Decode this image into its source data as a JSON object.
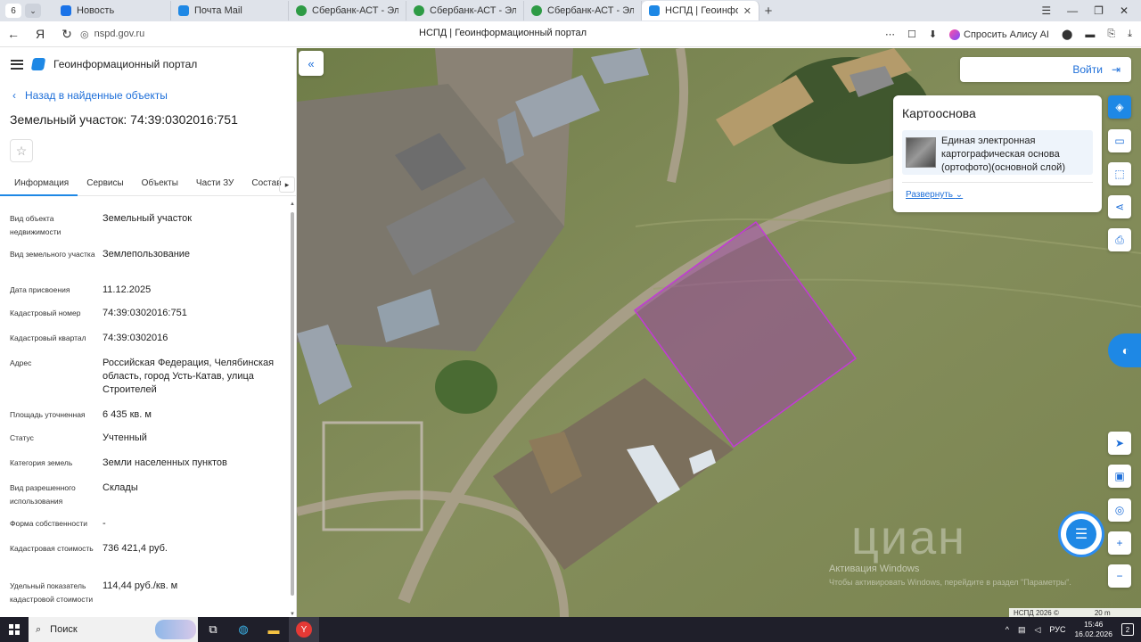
{
  "browser": {
    "tab_count": "6",
    "tabs": [
      {
        "title": "Новость",
        "color": "#1a73e8"
      },
      {
        "title": "Почта Mail",
        "color": "#1e88e5"
      },
      {
        "title": "Сбербанк-АСТ - Электрон",
        "color": "#2e9b45"
      },
      {
        "title": "Сбербанк-АСТ - Электрон",
        "color": "#2e9b45"
      },
      {
        "title": "Сбербанк-АСТ - Электрон",
        "color": "#2e9b45"
      },
      {
        "title": "НСПД | Геоинформацио",
        "color": "#1e88e5"
      }
    ],
    "url": "nspd.gov.ru",
    "page_title": "НСПД | Геоинформационный портал",
    "alisa_label": "Спросить Алису AI"
  },
  "panel": {
    "portal_name": "Геоинформационный портал",
    "back_label": "Назад в найденные объекты",
    "object_title": "Земельный участок: 74:39:0302016:751",
    "tabs": [
      "Информация",
      "Сервисы",
      "Объекты",
      "Части ЗУ",
      "Состав"
    ],
    "attributes": [
      {
        "label": "Вид объекта недвижимости",
        "value": "Земельный участок"
      },
      {
        "label": "Вид земельного участка",
        "value": "Землепользование"
      },
      {
        "label": "Дата присвоения",
        "value": "11.12.2025"
      },
      {
        "label": "Кадастровый номер",
        "value": "74:39:0302016:751"
      },
      {
        "label": "Кадастровый квартал",
        "value": "74:39:0302016"
      },
      {
        "label": "Адрес",
        "value": "Российская Федерация, Челябинская область, город Усть-Катав, улица Строителей"
      },
      {
        "label": "Площадь уточненная",
        "value": "6 435 кв. м"
      },
      {
        "label": "Статус",
        "value": "Учтенный"
      },
      {
        "label": "Категория земель",
        "value": "Земли населенных пунктов"
      },
      {
        "label": "Вид разрешенного использования",
        "value": "Склады"
      },
      {
        "label": "Форма собственности",
        "value": "-"
      },
      {
        "label": "Кадастровая стоимость",
        "value": "736 421,4 руб."
      },
      {
        "label": "Удельный показатель кадастровой стоимости",
        "value": "114,44 руб./кв. м"
      }
    ]
  },
  "map": {
    "login_label": "Войти",
    "basemap_title": "Картооснова",
    "basemap_layer": "Единая электронная картографическая основа (ортофото)(основной слой)",
    "expand_label": "Развернуть",
    "watermark_title": "Активация Windows",
    "watermark_text": "Чтобы активировать Windows, перейдите в раздел \"Параметры\".",
    "cian_mark": "циан",
    "copyright": "НСПД 2026 ©",
    "scale": "20 m",
    "parcel_color": "#9c3aa8"
  },
  "taskbar": {
    "search_label": "Поиск",
    "lang": "РУС",
    "time": "15:46",
    "date": "16.02.2026",
    "notifications": "2"
  }
}
